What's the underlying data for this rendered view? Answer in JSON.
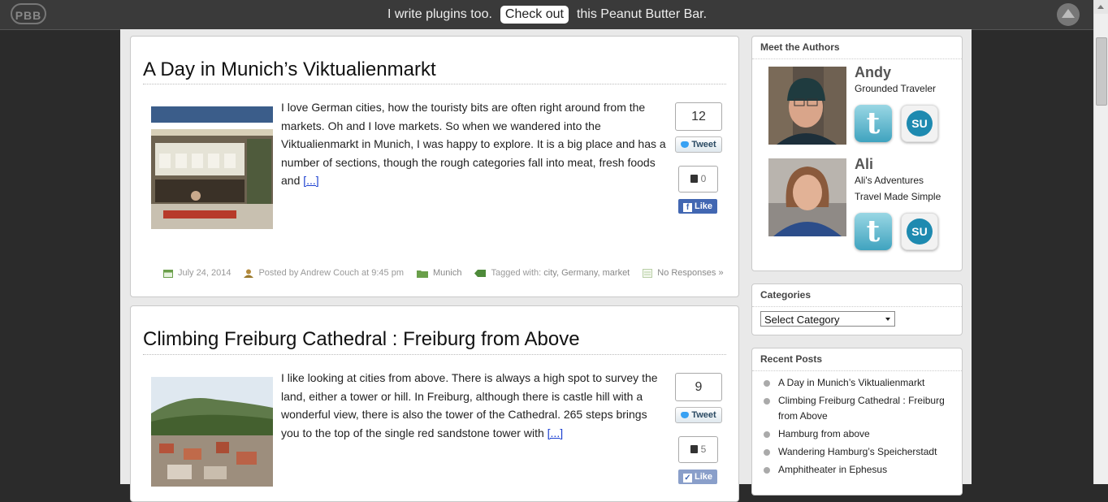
{
  "top_bar": {
    "logo": "PBB",
    "message_before": "I write plugins too.",
    "button_label": "Check out",
    "message_after": "this Peanut Butter Bar."
  },
  "posts": [
    {
      "title": "A Day in Munich’s Viktualienmarkt",
      "excerpt": "I love German cities, how the touristy bits are often right around from the markets. Oh and I love markets. So when we wandered into the Viktualienmarkt in Munich, I was happy to explore. It is a big place and has a number of sections, though the rough categories fall into meat, fresh foods and",
      "more_link": "[...]",
      "tweet_count": "12",
      "tweet_label": "Tweet",
      "like_count": "0",
      "like_label": "Like",
      "date": "July 24, 2014",
      "posted_by": "Posted by Andrew Couch at 9:45 pm",
      "category": "Munich",
      "tagged_prefix": "Tagged with:",
      "tags": "city, Germany, market",
      "responses": "No Responses »"
    },
    {
      "title": "Climbing Freiburg Cathedral : Freiburg from Above",
      "excerpt": "I like looking at cities from above. There is always a high spot to survey the land, either a tower or hill. In Freiburg, although there is castle hill with a wonderful view, there is also the tower of the Cathedral. 265 steps brings you to the top of the single red sandstone tower with",
      "more_link": "[...]",
      "tweet_count": "9",
      "tweet_label": "Tweet",
      "like_count": "5",
      "like_label": "Like"
    }
  ],
  "sidebar": {
    "authors": {
      "title": "Meet the Authors",
      "list": [
        {
          "name": "Andy",
          "lines": [
            "Grounded Traveler"
          ]
        },
        {
          "name": "Ali",
          "lines": [
            "Ali's Adventures",
            "Travel Made Simple"
          ]
        }
      ]
    },
    "categories": {
      "title": "Categories",
      "selected": "Select Category"
    },
    "recent_posts": {
      "title": "Recent Posts",
      "items": [
        "A Day in Munich’s Viktualienmarkt",
        "Climbing Freiburg Cathedral : Freiburg from Above",
        "Hamburg from above",
        "Wandering Hamburg’s Speicherstadt",
        "Amphitheater in Ephesus"
      ]
    }
  },
  "icons": {
    "scroll_top": "arrow-up-icon",
    "tweet": "twitter-bird-icon",
    "like": "thumbs-up-icon",
    "facebook": "facebook-icon",
    "date": "calendar-icon",
    "author": "user-icon",
    "category": "folder-icon",
    "tags": "tag-icon",
    "comments": "comment-icon",
    "twitter_social": "twitter-icon",
    "stumbleupon_social": "stumbleupon-icon"
  }
}
